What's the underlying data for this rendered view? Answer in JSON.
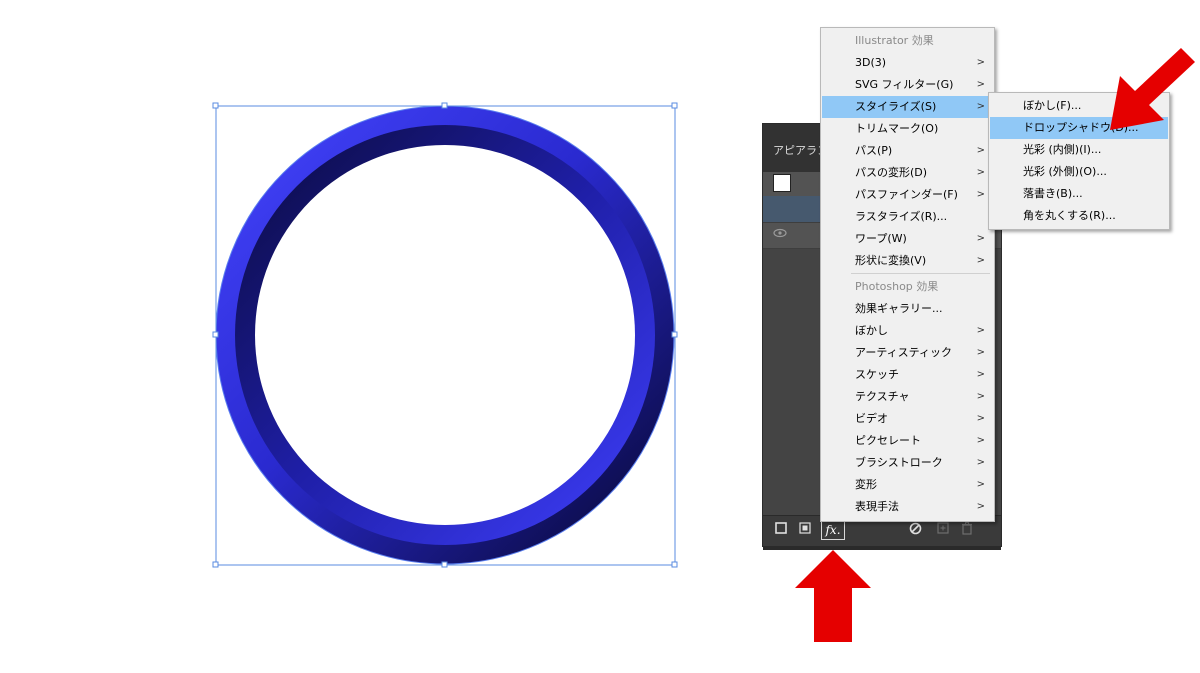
{
  "appearance_panel": {
    "title": "アピアランス",
    "footer_fx": "fx."
  },
  "main_menu": {
    "illustrator_header": "Illustrator 効果",
    "illustrator_items": [
      {
        "label": "3D(3)",
        "submenu": true
      },
      {
        "label": "SVG フィルター(G)",
        "submenu": true
      },
      {
        "label": "スタイライズ(S)",
        "submenu": true,
        "highlighted": true
      },
      {
        "label": "トリムマーク(O)",
        "submenu": false
      },
      {
        "label": "パス(P)",
        "submenu": true
      },
      {
        "label": "パスの変形(D)",
        "submenu": true
      },
      {
        "label": "パスファインダー(F)",
        "submenu": true
      },
      {
        "label": "ラスタライズ(R)...",
        "submenu": false
      },
      {
        "label": "ワープ(W)",
        "submenu": true
      },
      {
        "label": "形状に変換(V)",
        "submenu": true
      }
    ],
    "photoshop_header": "Photoshop 効果",
    "photoshop_items": [
      {
        "label": "効果ギャラリー...",
        "submenu": false
      },
      {
        "label": "ぼかし",
        "submenu": true
      },
      {
        "label": "アーティスティック",
        "submenu": true
      },
      {
        "label": "スケッチ",
        "submenu": true
      },
      {
        "label": "テクスチャ",
        "submenu": true
      },
      {
        "label": "ビデオ",
        "submenu": true
      },
      {
        "label": "ピクセレート",
        "submenu": true
      },
      {
        "label": "ブラシストローク",
        "submenu": true
      },
      {
        "label": "変形",
        "submenu": true
      },
      {
        "label": "表現手法",
        "submenu": true
      }
    ]
  },
  "sub_menu": {
    "items": [
      {
        "label": "ぼかし(F)..."
      },
      {
        "label": "ドロップシャドウ(D)...",
        "highlighted": true
      },
      {
        "label": "光彩 (内側)(I)..."
      },
      {
        "label": "光彩 (外側)(O)..."
      },
      {
        "label": "落書き(B)..."
      },
      {
        "label": "角を丸くする(R)..."
      }
    ]
  },
  "colors": {
    "ring_blue": "#3b3bff",
    "ring_dark": "#0a0a45",
    "selection_blue": "#4f7fd8",
    "menu_highlight": "#90c8f6",
    "arrow_red": "#e50000"
  },
  "icons": {
    "submenu_arrow": ">"
  }
}
